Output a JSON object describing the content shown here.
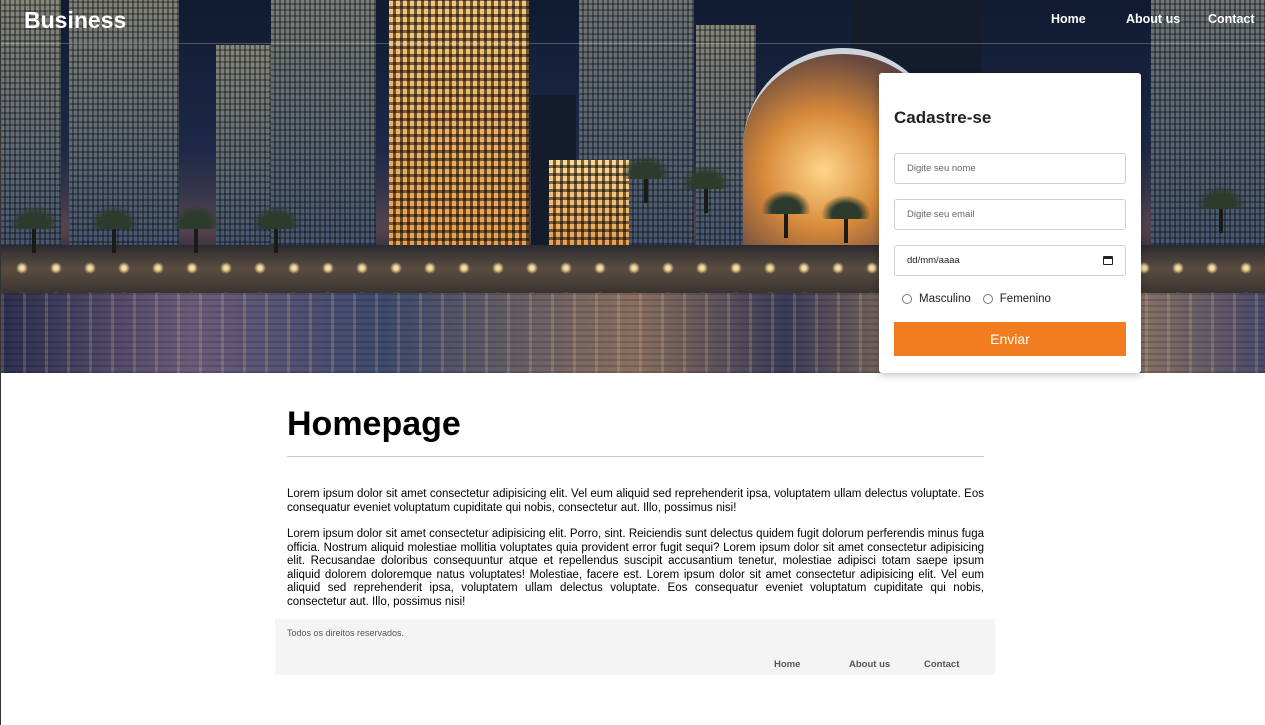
{
  "header": {
    "brand": "Business",
    "nav": [
      "Home",
      "About us",
      "Contact"
    ]
  },
  "signup_form": {
    "title": "Cadastre-se",
    "name_placeholder": "Digite seu nome",
    "email_placeholder": "Digite seu email",
    "date_placeholder": "dd/mm/aaaa",
    "gender_options": [
      "Masculino",
      "Femenino"
    ],
    "submit_label": "Enviar"
  },
  "main": {
    "title": "Homepage",
    "paragraphs": [
      "Lorem ipsum dolor sit amet consectetur adipisicing elit. Vel eum aliquid sed reprehenderit ipsa, voluptatem ullam delectus voluptate. Eos consequatur eveniet voluptatum cupiditate qui nobis, consectetur aut. Illo, possimus nisi!",
      "Lorem ipsum dolor sit amet consectetur adipisicing elit. Porro, sint. Reiciendis sunt delectus quidem fugit dolorum perferendis minus fuga officia. Nostrum aliquid molestiae mollitia voluptates quia provident error fugit sequi? Lorem ipsum dolor sit amet consectetur adipisicing elit. Recusandae doloribus consequuntur atque et repellendus suscipit accusantium tenetur, molestiae adipisci totam saepe ipsum aliquid dolorem doloremque natus voluptates! Molestiae, facere est. Lorem ipsum dolor sit amet consectetur adipisicing elit. Vel eum aliquid sed reprehenderit ipsa, voluptatem ullam delectus voluptate. Eos consequatur eveniet voluptatum cupiditate qui nobis, consectetur aut. Illo, possimus nisi!"
    ]
  },
  "footer": {
    "copyright": "Todos os direitos reservados.",
    "nav": [
      "Home",
      "About us",
      "Contact"
    ]
  },
  "colors": {
    "accent": "#f27d20",
    "footer_bg": "#f4f4f4"
  },
  "icons": {
    "date_picker": "calendar-icon"
  }
}
